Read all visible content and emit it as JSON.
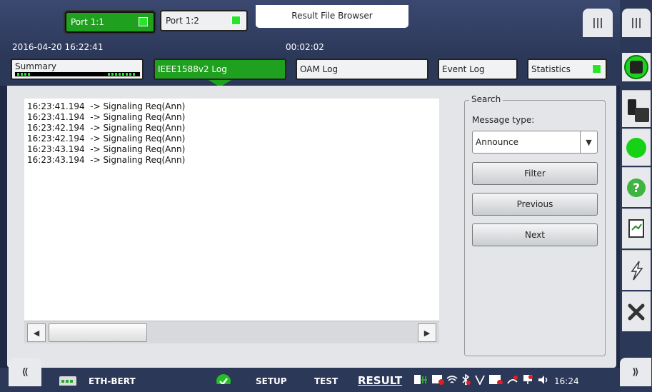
{
  "header": {
    "ports": [
      {
        "label": "Port 1:1",
        "active": true
      },
      {
        "label": "Port 1:2",
        "active": false
      }
    ],
    "title": "Result File Browser",
    "datetime": "2016-04-20 16:22:41",
    "elapsed": "00:02:02"
  },
  "tabs": [
    {
      "label": "Summary"
    },
    {
      "label": "IEEE1588v2 Log",
      "active": true
    },
    {
      "label": "OAM Log"
    },
    {
      "label": "Event Log"
    },
    {
      "label": "Statistics"
    }
  ],
  "log": {
    "lines": [
      "16:23:41.194  -> Signaling Req(Ann)",
      "16:23:41.194  -> Signaling Req(Ann)",
      "16:23:42.194  -> Signaling Req(Ann)",
      "16:23:42.194  -> Signaling Req(Ann)",
      "16:23:43.194  -> Signaling Req(Ann)",
      "16:23:43.194  -> Signaling Req(Ann)"
    ]
  },
  "search": {
    "legend": "Search",
    "message_type_label": "Message type:",
    "message_type_value": "Announce",
    "filter_label": "Filter",
    "previous_label": "Previous",
    "next_label": "Next"
  },
  "bottombar": {
    "app_name": "ETH-BERT",
    "setup_label": "SETUP",
    "test_label": "TEST",
    "result_label": "RESULT",
    "clock": "16:24"
  },
  "icons": {
    "menu": "menu-icon",
    "stop": "stop-icon",
    "traffic": "traffic-light-icon",
    "status": "status-led-icon",
    "help": "help-icon",
    "report": "report-icon",
    "inject": "lightning-icon",
    "close": "close-icon"
  },
  "colors": {
    "accent_green": "#1fa11f",
    "led_green": "#27e52a",
    "chrome": "#2c3858"
  }
}
